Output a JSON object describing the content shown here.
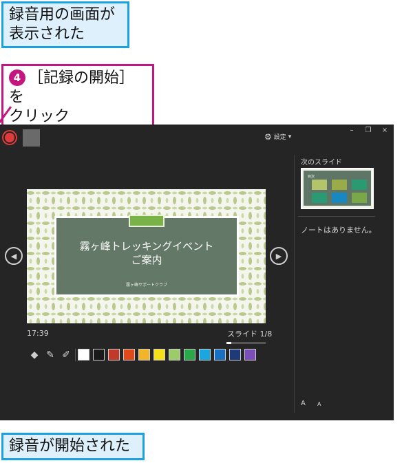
{
  "callouts": {
    "top_line1": "録音用の画面が",
    "top_line2": "表示された",
    "step_number": "4",
    "step_line1": "［記録の開始］を",
    "step_line2": "クリック",
    "bottom": "録音が開始された"
  },
  "toolbar": {
    "record_icon": "record-icon",
    "stop_icon": "stop-icon",
    "settings_label": "設定",
    "settings_caret": "▾",
    "gear_icon": "⚙",
    "minimize": "–",
    "restore": "❐",
    "close": "×"
  },
  "slide": {
    "title_line1": "霧ヶ峰トレッキングイベント",
    "title_line2": "ご案内",
    "subtitle": "霧ヶ峰サポートクラブ",
    "prev_arrow": "◀",
    "next_arrow": "▶"
  },
  "status": {
    "timer": "17:39",
    "slide_counter": "スライド 1/8",
    "progress_fraction": 0.125
  },
  "pen_tools": [
    {
      "name": "eraser-icon",
      "glyph": "◆"
    },
    {
      "name": "pen-icon",
      "glyph": "✎"
    },
    {
      "name": "highlighter-icon",
      "glyph": "✐"
    }
  ],
  "colors": [
    "#ffffff",
    "#1a1a1a",
    "#c0392b",
    "#e04a1a",
    "#f2b42a",
    "#f5e11a",
    "#9ccb6a",
    "#2aa84a",
    "#1aa7e0",
    "#1a70c0",
    "#1f3a78",
    "#7a4fb8"
  ],
  "sidebar": {
    "next_slide_label": "次のスライド",
    "thumb_heading": "目次",
    "thumb_boxes": [
      {
        "color": "#b4c46a"
      },
      {
        "color": "#9aac4a"
      },
      {
        "color": "#2a9a72"
      },
      {
        "color": "#2a9a72"
      },
      {
        "color": "#1a88c0"
      },
      {
        "color": "#7aa848"
      }
    ],
    "notes_text": "ノートはありません。",
    "font_larger": "A",
    "font_smaller": "A"
  }
}
